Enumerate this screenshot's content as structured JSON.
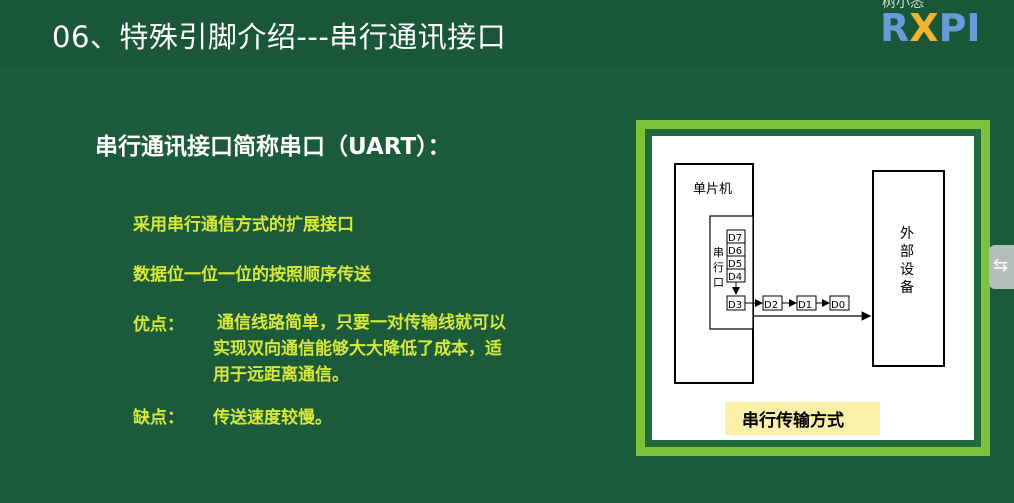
{
  "slide": {
    "title": "06、特殊引脚介绍---串行通讯接口",
    "logo": {
      "small_text": "树小悉",
      "main_r": "R",
      "main_x": "X",
      "main_pi": "PI"
    },
    "heading": "串行通讯接口简称串口（UART）：",
    "bullets": [
      "采用串行通信方式的扩展接口",
      "数据位一位一位的按照顺序传送"
    ],
    "advantages": {
      "label": "优点：",
      "lines": [
        "通信线路简单，只要一对传输线就可以",
        "实现双向通信能够大大降低了成本，适",
        "用于远距离通信。"
      ]
    },
    "disadvantages": {
      "label": "缺点：",
      "text": "传送速度较慢。"
    }
  },
  "diagram": {
    "mcu_label": "单片机",
    "serial_port_label": [
      "串",
      "行",
      "口"
    ],
    "register_bits": [
      "D7",
      "D6",
      "D5",
      "D4"
    ],
    "output_bit": "D3",
    "transmitted_bits": [
      "D2",
      "D1",
      "D0"
    ],
    "device_label": [
      "外",
      "部",
      "设",
      "备"
    ],
    "caption": "串行传输方式"
  },
  "colors": {
    "background": "#1b5a3a",
    "title_text": "#ffffff",
    "bullet_text": "#d7e83a",
    "frame_border": "#7cc13a",
    "caption_bg": "#fbf0a8",
    "logo_blue": "#6a9ad8",
    "logo_orange": "#f2b331"
  },
  "side_tab_icon": "collapse-arrows-icon"
}
